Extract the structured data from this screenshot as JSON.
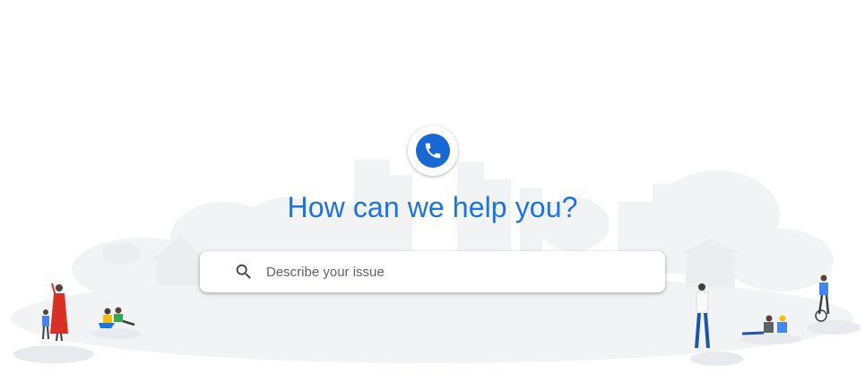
{
  "header": {
    "title": "How can we help you?"
  },
  "search": {
    "placeholder": "Describe your issue",
    "value": ""
  },
  "icons": {
    "logo": "phone-icon",
    "search": "search-icon"
  },
  "colors": {
    "brand_blue": "#1a73e8",
    "logo_blue": "#1967d2",
    "title_blue": "#1a73e8",
    "backdrop_gray": "#f1f3f4"
  }
}
